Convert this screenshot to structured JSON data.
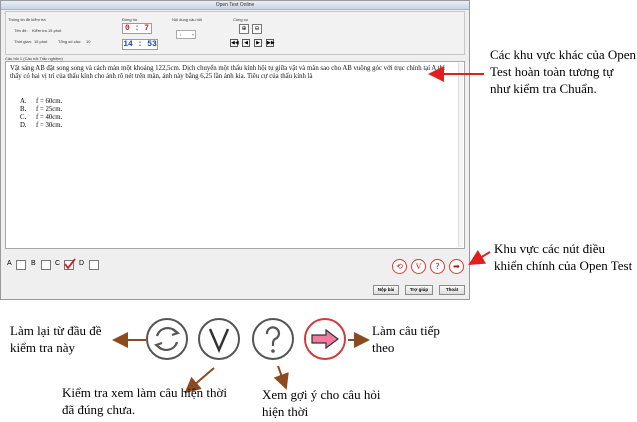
{
  "window": {
    "title": "Open Test Online",
    "info_section_label": "Thông tin",
    "subsection_label": "Thông tin đề kiểm tra",
    "name_label": "Tên đề:",
    "name_value": "Kiểm tra 15 phút",
    "time_label": "Thời gian:",
    "time_value": "15 phút",
    "total_label": "Tổng số câu:",
    "total_value": "10",
    "clock_label": "Đồng hồ",
    "clock_elapsed": "0 : 7",
    "clock_remaining": "14 : 53",
    "content_label": "Nội dung câu hỏi",
    "content_select_value": "1",
    "tools_label": "Công cụ",
    "nav_buttons": [
      "◀◀",
      "◀",
      "▶",
      "▶▶"
    ]
  },
  "question": {
    "header": "Câu hỏi 1 (Câu hỏi Trắc nghiệm)",
    "text": "Vật sáng AB đặt song song và cách màn một khoảng 122,5cm. Dịch chuyển một thấu kính hội tụ giữa vật và màn sao cho AB vuông góc với trục chính tại A thì thấy có hai vị trí của thấu kính cho ảnh rõ nét trên màn, ảnh này bằng 6,25 lần ảnh kia. Tiêu cự của thấu kính là",
    "options": [
      {
        "letter": "A.",
        "text": "f = 60cm."
      },
      {
        "letter": "B.",
        "text": "f = 25cm."
      },
      {
        "letter": "C.",
        "text": "f = 40cm."
      },
      {
        "letter": "D.",
        "text": "f = 30cm."
      }
    ]
  },
  "answers": [
    {
      "letter": "A",
      "checked": false
    },
    {
      "letter": "B",
      "checked": false
    },
    {
      "letter": "C",
      "checked": true
    },
    {
      "letter": "D",
      "checked": false
    }
  ],
  "controls": {
    "restart_symbol": "⟲",
    "check_symbol": "V",
    "hint_symbol": "?",
    "next_symbol": "➡"
  },
  "bottom_buttons": {
    "submit": "Nộp bài",
    "help": "Trợ giúp",
    "exit": "Thoát"
  },
  "annotations": {
    "other_areas": "Các khu vực khác của Open Test hoàn toàn tương tự như kiểm tra Chuẩn.",
    "control_area": "Khu vực các nút điều khiển chính của Open Test",
    "restart": "Làm lại từ đầu đề kiểm tra này",
    "check": "Kiểm tra xem làm câu hiện thời đã đúng chưa.",
    "hint": "Xem gợi ý cho câu hỏi hiện thời",
    "next": "Làm câu tiếp theo"
  },
  "colors": {
    "timer_elapsed": "#d41a1a",
    "timer_remaining": "#1a3fbf",
    "control_accent": "#d23b3b",
    "arrow_red": "#e02020",
    "arrow_brown": "#8b4a1f",
    "next_fill": "#f07aa0"
  }
}
